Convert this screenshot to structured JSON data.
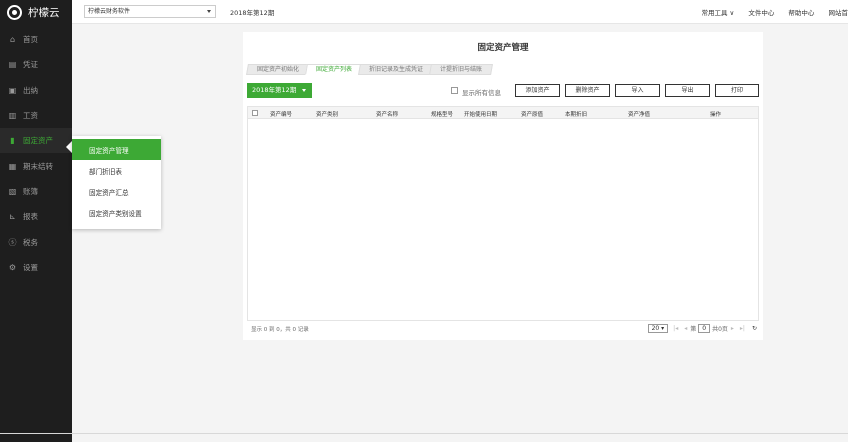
{
  "app": {
    "name": "柠檬云"
  },
  "sidebar": {
    "items": [
      {
        "label": "首页",
        "icon": "home-icon",
        "glyph": "⌂"
      },
      {
        "label": "凭证",
        "icon": "voucher-icon",
        "glyph": "▤"
      },
      {
        "label": "出纳",
        "icon": "cashier-icon",
        "glyph": "▣"
      },
      {
        "label": "工资",
        "icon": "salary-icon",
        "glyph": "▥"
      },
      {
        "label": "固定资产",
        "icon": "fixed-asset-icon",
        "glyph": "▮"
      },
      {
        "label": "期末结转",
        "icon": "period-close-icon",
        "glyph": "▦"
      },
      {
        "label": "账簿",
        "icon": "ledger-icon",
        "glyph": "▧"
      },
      {
        "label": "报表",
        "icon": "report-icon",
        "glyph": "⊾"
      },
      {
        "label": "税务",
        "icon": "tax-icon",
        "glyph": "ⓢ"
      },
      {
        "label": "设置",
        "icon": "settings-icon",
        "glyph": "⚙"
      }
    ],
    "active_index": 4
  },
  "submenu": {
    "items": [
      "固定资产管理",
      "部门折旧表",
      "固定资产汇总",
      "固定资产类别设置"
    ]
  },
  "topbar": {
    "company": "柠檬云财务软件",
    "period": "2018年第12期",
    "links": [
      "常用工具 ∨",
      "文件中心",
      "帮助中心",
      "网站首"
    ]
  },
  "panel": {
    "title": "固定资产管理",
    "tabs": [
      "固定资产初始化",
      "固定资产列表",
      "折旧记录及生成凭证",
      "计提折旧与结账"
    ],
    "active_tab": 1
  },
  "toolbar": {
    "period_select": "2018年第12期",
    "show_all_label": "显示所有信息",
    "buttons": [
      "添加资产",
      "删除资产",
      "导入",
      "导出",
      "打印"
    ]
  },
  "table": {
    "columns": [
      "资产编号",
      "资产类别",
      "资产名称",
      "规格型号",
      "开始使用日期",
      "资产原值",
      "本期折旧",
      "资产净值",
      "操作"
    ]
  },
  "footer": {
    "info": "显示 0 到 0，共 0 记录",
    "page_size": "20",
    "page_prefix": "第",
    "page_value": "0",
    "page_suffix": "共0页"
  }
}
